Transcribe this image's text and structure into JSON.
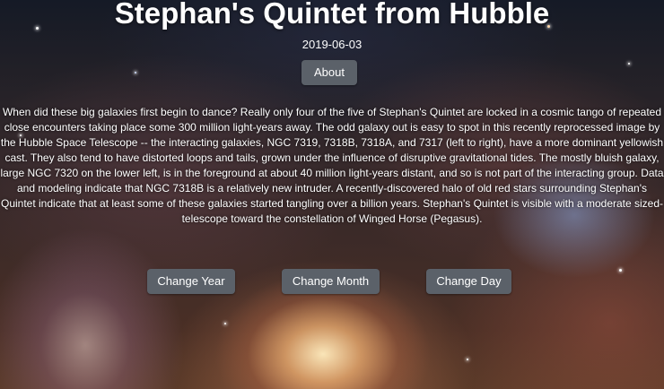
{
  "page": {
    "title": "Stephan's Quintet from Hubble",
    "date": "2019-06-03",
    "about_label": "About",
    "explanation": "When did these big galaxies first begin to dance? Really only four of the five of Stephan's Quintet are locked in a cosmic tango of repeated close encounters taking place some 300 million light-years away. The odd galaxy out is easy to spot in this recently reprocessed image by the Hubble Space Telescope -- the interacting galaxies, NGC 7319, 7318B, 7318A, and 7317 (left to right), have a more dominant yellowish cast. They also tend to have distorted loops and tails, grown under the influence of disruptive gravitational tides. The mostly bluish galaxy, large NGC 7320 on the lower left, is in the foreground at about 40 million light-years distant, and so is not part of the interacting group. Data and modeling indicate that NGC 7318B is a relatively new intruder. A recently-discovered halo of old red stars surrounding Stephan's Quintet indicate that at least some of these galaxies started tangling over a billion years. Stephan's Quintet is visible with a moderate sized-telescope toward the constellation of Winged Horse (Pegasus)."
  },
  "controls": {
    "change_year_label": "Change Year",
    "change_month_label": "Change Month",
    "change_day_label": "Change Day"
  },
  "colors": {
    "button_bg": "#5b6169",
    "text": "#ffffff"
  }
}
